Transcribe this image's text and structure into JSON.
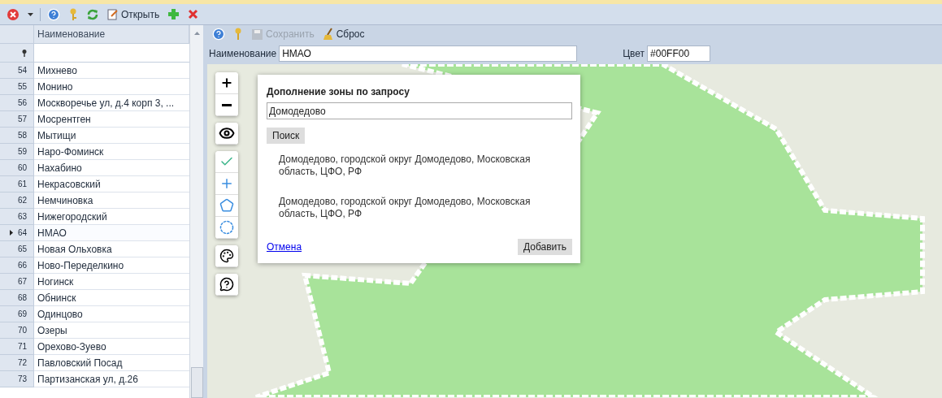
{
  "toolbar": {
    "open_label": "Открыть"
  },
  "grid": {
    "columns": [
      "Наименование"
    ],
    "rows": [
      {
        "number": "54",
        "name": "Михнево",
        "selected": false
      },
      {
        "number": "55",
        "name": "Монино",
        "selected": false
      },
      {
        "number": "56",
        "name": "Москворечье ул, д.4 корп 3, ...",
        "selected": false
      },
      {
        "number": "57",
        "name": "Мосрентген",
        "selected": false
      },
      {
        "number": "58",
        "name": "Мытищи",
        "selected": false
      },
      {
        "number": "59",
        "name": "Наро-Фоминск",
        "selected": false
      },
      {
        "number": "60",
        "name": "Нахабино",
        "selected": false
      },
      {
        "number": "61",
        "name": "Некрасовский",
        "selected": false
      },
      {
        "number": "62",
        "name": "Немчиновка",
        "selected": false
      },
      {
        "number": "63",
        "name": "Нижегородский",
        "selected": false
      },
      {
        "number": "64",
        "name": "НМАО",
        "selected": true
      },
      {
        "number": "65",
        "name": "Новая Ольховка",
        "selected": false
      },
      {
        "number": "66",
        "name": "Ново-Переделкино",
        "selected": false
      },
      {
        "number": "67",
        "name": "Ногинск",
        "selected": false
      },
      {
        "number": "68",
        "name": "Обнинск",
        "selected": false
      },
      {
        "number": "69",
        "name": "Одинцово",
        "selected": false
      },
      {
        "number": "70",
        "name": "Озеры",
        "selected": false
      },
      {
        "number": "71",
        "name": "Орехово-Зуево",
        "selected": false
      },
      {
        "number": "72",
        "name": "Павловский Посад",
        "selected": false
      },
      {
        "number": "73",
        "name": "Партизанская ул, д.26",
        "selected": false
      }
    ]
  },
  "editor": {
    "toolbar": {
      "save_label": "Сохранить",
      "save_disabled": true,
      "reset_label": "Сброс"
    },
    "fields": [
      {
        "label": "Наименование",
        "value": "НМАО"
      },
      {
        "label": "Цвет",
        "value": "#00FF00"
      }
    ]
  },
  "dialog": {
    "title": "Дополнение зоны по запросу",
    "query": "Домодедово",
    "search_button": "Поиск",
    "results": [
      "Домодедово, городской округ Домодедово, Московская область, ЦФО, РФ",
      "Домодедово, городской округ Домодедово, Московская область, ЦФО, РФ"
    ],
    "cancel_link": "Отмена",
    "add_button": "Добавить"
  }
}
